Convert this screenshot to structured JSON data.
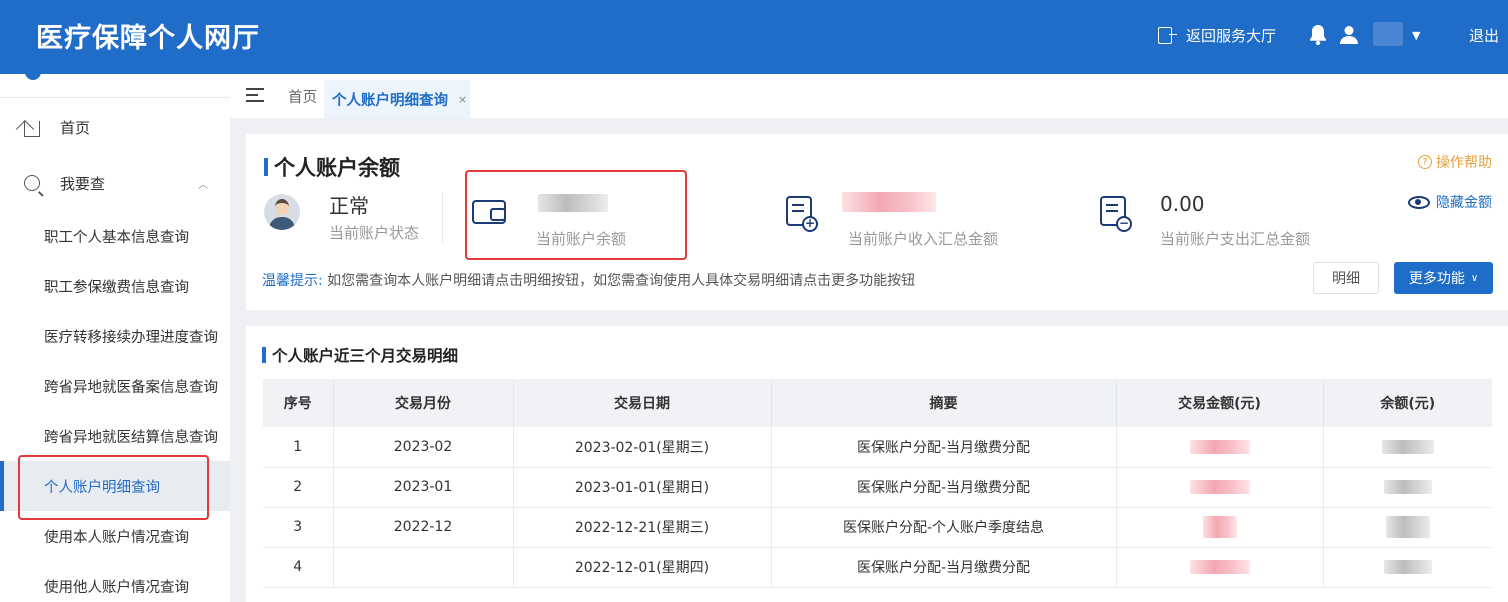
{
  "header": {
    "brand": "医疗保障个人网厅",
    "back_label": "返回服务大厅",
    "bell_icon": "bell-icon",
    "user_icon": "user-icon",
    "caret": "▼",
    "logout_label": "退出"
  },
  "sidebar": {
    "home_label": "首页",
    "query_label": "我要查",
    "chevron": "︿",
    "items": [
      {
        "label": "职工个人基本信息查询"
      },
      {
        "label": "职工参保缴费信息查询"
      },
      {
        "label": "医疗转移接续办理进度查询"
      },
      {
        "label": "跨省异地就医备案信息查询"
      },
      {
        "label": "跨省异地就医结算信息查询"
      },
      {
        "label": "个人账户明细查询"
      },
      {
        "label": "使用本人账户情况查询"
      },
      {
        "label": "使用他人账户情况查询"
      }
    ]
  },
  "tabs": {
    "home": "首页",
    "active": "个人账户明细查询",
    "close": "×"
  },
  "balance_card": {
    "title": "个人账户余额",
    "help_label": "操作帮助",
    "help_mark": "?",
    "hide_label": "隐藏金额",
    "status_value": "正常",
    "status_label": "当前账户状态",
    "balance_label": "当前账户余额",
    "income_label": "当前账户收入汇总金额",
    "expense_value": "0.00",
    "expense_label": "当前账户支出汇总金额",
    "income_icon_symbol": "+",
    "expense_icon_symbol": "−",
    "tip_label": "温馨提示:",
    "tip_text": "如您需查询本人账户明细请点击明细按钮，如您需查询使用人具体交易明细请点击更多功能按钮",
    "detail_button": "明细",
    "more_button": "更多功能",
    "more_chevron": "∨"
  },
  "transactions": {
    "title": "个人账户近三个月交易明细",
    "columns": [
      "序号",
      "交易月份",
      "交易日期",
      "摘要",
      "交易金额(元)",
      "余额(元)"
    ],
    "rows": [
      {
        "no": "1",
        "month": "2023-02",
        "date": "2023-02-01(星期三)",
        "summary": "医保账户分配-当月缴费分配"
      },
      {
        "no": "2",
        "month": "2023-01",
        "date": "2023-01-01(星期日)",
        "summary": "医保账户分配-当月缴费分配"
      },
      {
        "no": "3",
        "month": "2022-12",
        "date": "2022-12-21(星期三)",
        "summary": "医保账户分配-个人账户季度结息"
      },
      {
        "no": "4",
        "month": "",
        "date": "2022-12-01(星期四)",
        "summary": "医保账户分配-当月缴费分配"
      }
    ]
  },
  "colors": {
    "primary": "#1f6cc9",
    "highlight_box": "#e23a3a",
    "help": "#e6a23c"
  }
}
